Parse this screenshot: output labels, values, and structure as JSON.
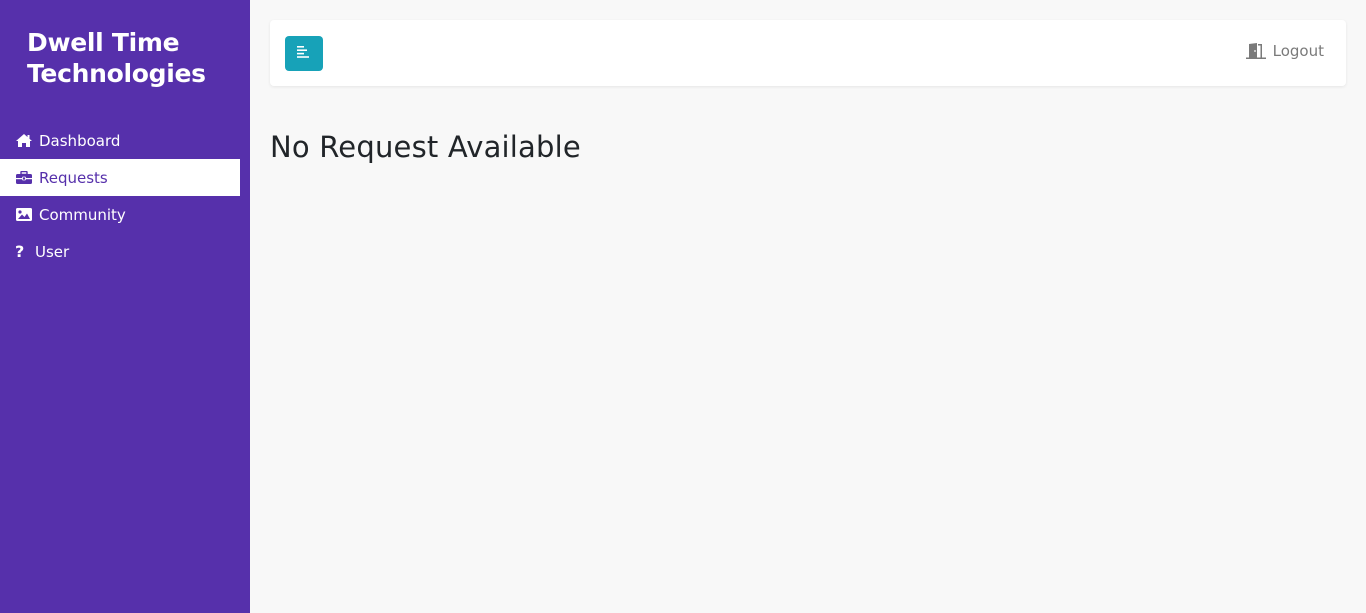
{
  "sidebar": {
    "brand": "Dwell Time Technologies",
    "items": [
      {
        "label": "Dashboard",
        "icon": "home-icon",
        "active": false
      },
      {
        "label": "Requests",
        "icon": "briefcase-icon",
        "active": true
      },
      {
        "label": "Community",
        "icon": "image-icon",
        "active": false
      },
      {
        "label": "User",
        "icon": "question-icon",
        "active": false
      }
    ]
  },
  "topbar": {
    "toggle_icon": "menu-align-left-icon",
    "logout_label": "Logout",
    "logout_icon": "door-exit-icon"
  },
  "main": {
    "title": "No Request Available"
  },
  "colors": {
    "sidebar_bg": "#5630ab",
    "accent": "#17a2b8",
    "page_bg": "#f8f8f8"
  }
}
